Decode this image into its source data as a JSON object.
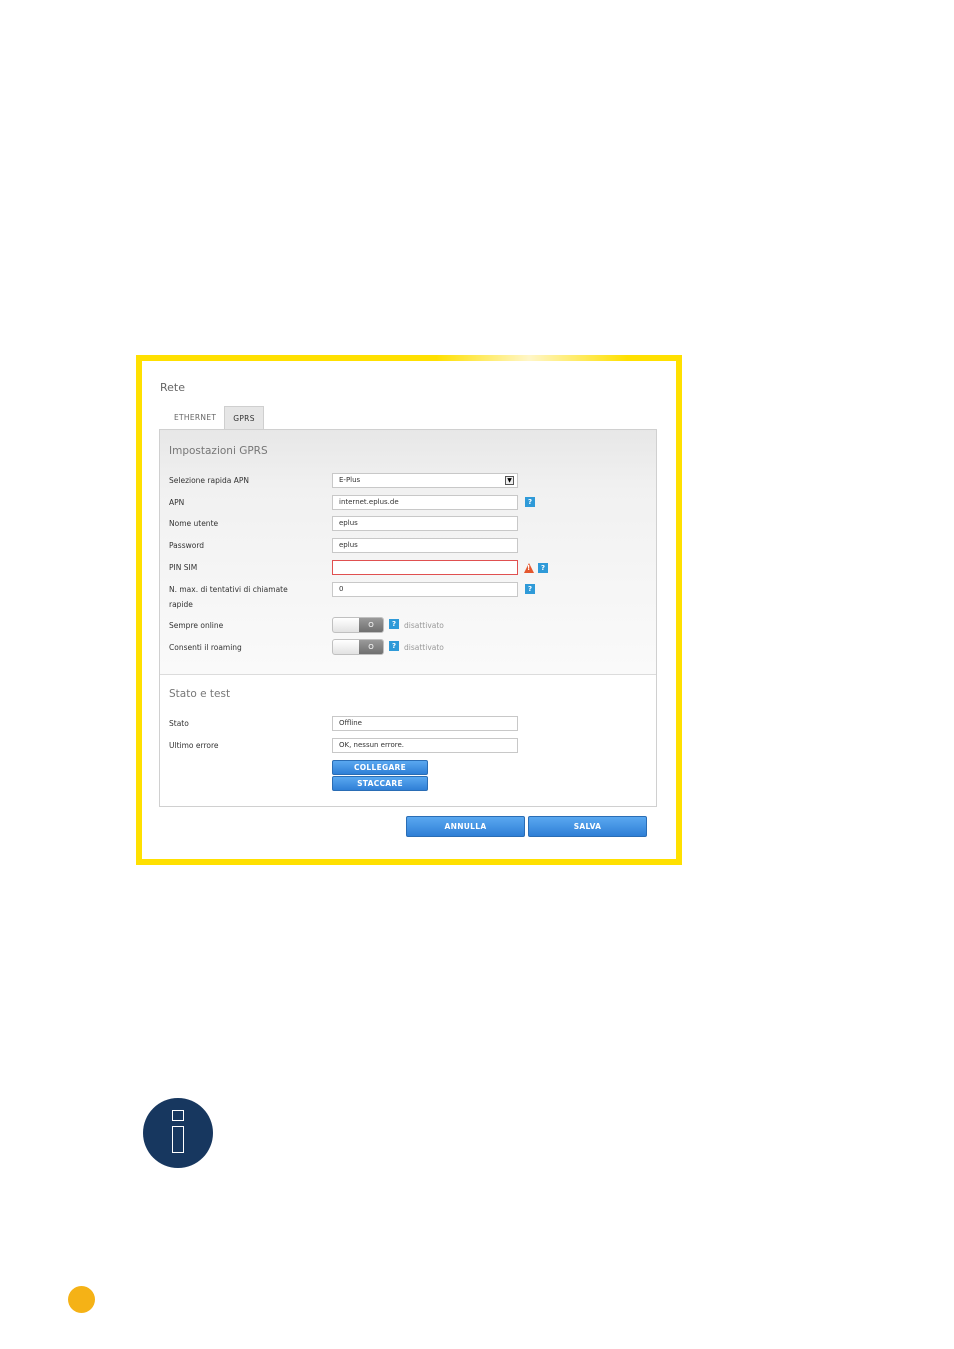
{
  "panel": {
    "title": "Rete",
    "tabs": [
      {
        "label": "ETHERNET",
        "active": false
      },
      {
        "label": "GPRS",
        "active": true
      }
    ]
  },
  "gprs": {
    "title": "Impostazioni GPRS",
    "apn_quick_label": "Selezione rapida APN",
    "apn_quick_value": "E-Plus",
    "apn_label": "APN",
    "apn_value": "internet.eplus.de",
    "user_label": "Nome utente",
    "user_value": "eplus",
    "password_label": "Password",
    "password_value": "eplus",
    "pin_label": "PIN SIM",
    "pin_value": "",
    "retries_label_1": "N. max. di tentativi di chiamate",
    "retries_label_2": "rapide",
    "retries_value": "0",
    "always_online_label": "Sempre online",
    "always_online_state": "disattivato",
    "roaming_label": "Consenti il roaming",
    "roaming_state": "disattivato",
    "help_symbol": "?",
    "warning_symbol": "!",
    "toggle_knob": "O"
  },
  "status": {
    "title": "Stato e test",
    "state_label": "Stato",
    "state_value": "Offline",
    "last_error_label": "Ultimo errore",
    "last_error_value": "OK, nessun errore.",
    "connect_button": "COLLEGARE",
    "disconnect_button": "STACCARE"
  },
  "footer": {
    "cancel_button": "ANNULLA",
    "save_button": "SALVA"
  },
  "colors": {
    "frame": "#ffe000",
    "button": "#2f7fd6",
    "help": "#2f9ad8",
    "warning": "#e4572e",
    "info_circle": "#17375f",
    "page_dot": "#f5b216"
  },
  "icons": {
    "help": "help-icon",
    "warning": "warning-icon",
    "info": "info-icon",
    "dropdown": "chevron-down-icon"
  }
}
